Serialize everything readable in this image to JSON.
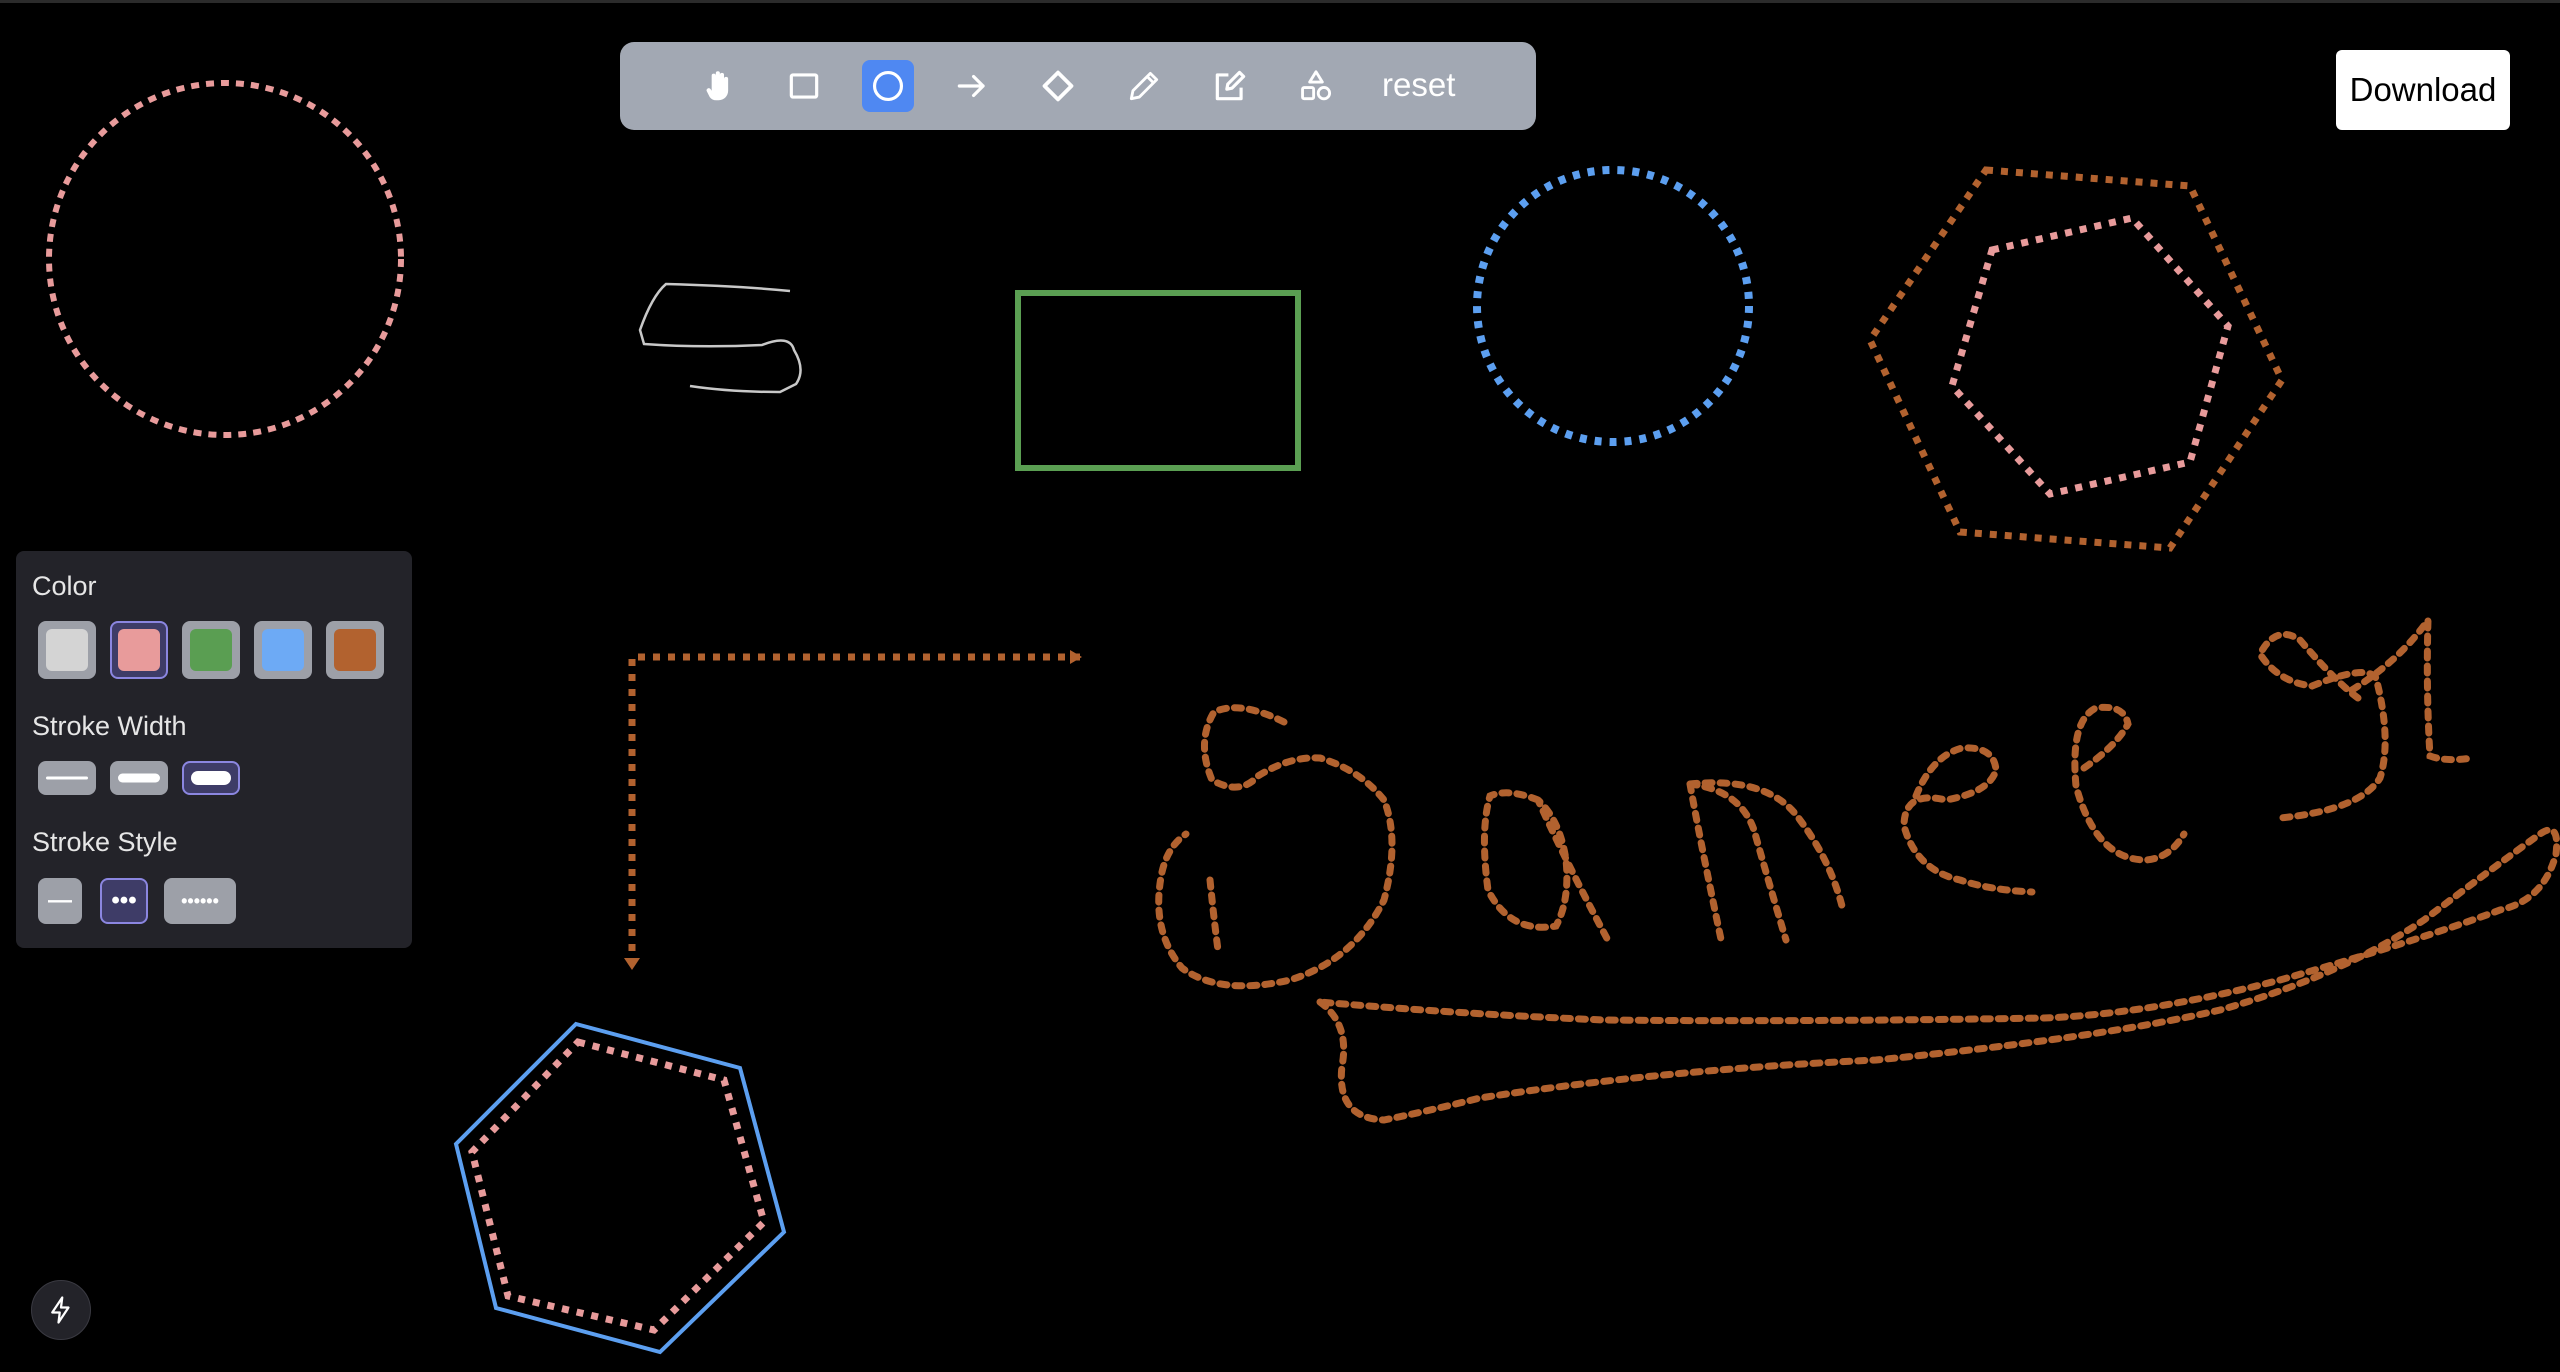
{
  "toolbar": {
    "tools": [
      {
        "name": "hand-icon",
        "active": false
      },
      {
        "name": "rectangle-icon",
        "active": false
      },
      {
        "name": "ellipse-icon",
        "active": true
      },
      {
        "name": "arrow-icon",
        "active": false
      },
      {
        "name": "diamond-icon",
        "active": false
      },
      {
        "name": "pencil-icon",
        "active": false
      },
      {
        "name": "edit-text-icon",
        "active": false
      },
      {
        "name": "shapes-icon",
        "active": false
      }
    ],
    "reset_label": "reset",
    "active_color": "#4f88f2"
  },
  "download_label": "Download",
  "panel": {
    "color_heading": "Color",
    "colors": [
      "#d4d4d4",
      "#e89b9b",
      "#5a9e52",
      "#6daaf5",
      "#b2622f"
    ],
    "selected_color_index": 1,
    "stroke_width_heading": "Stroke Width",
    "stroke_widths": [
      "thin",
      "medium",
      "thick"
    ],
    "selected_stroke_width_index": 2,
    "stroke_style_heading": "Stroke Style",
    "stroke_styles": [
      {
        "id": "solid",
        "glyph": "—"
      },
      {
        "id": "dotted",
        "glyph": "•••"
      },
      {
        "id": "dashed",
        "glyph": "••••••"
      }
    ],
    "selected_stroke_style_index": 1
  },
  "canvas_colors": {
    "pink": "#e89b9b",
    "blue": "#5c9ff0",
    "green": "#5a9e52",
    "orange": "#b2622f",
    "gray": "#c8c8c8"
  },
  "quick_button_icon": "lightning-icon"
}
